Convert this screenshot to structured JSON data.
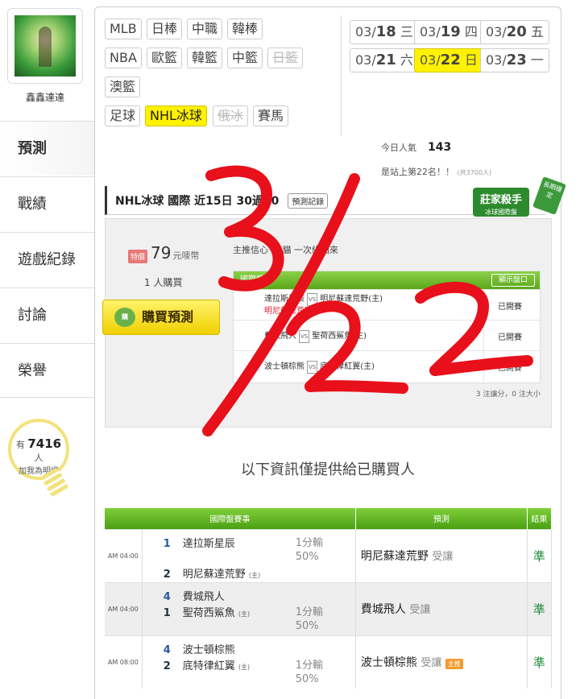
{
  "user": {
    "name": "鑫鑫達達"
  },
  "nav": [
    {
      "label": "預測",
      "active": true
    },
    {
      "label": "戰績",
      "active": false
    },
    {
      "label": "遊戲紀錄",
      "active": false
    },
    {
      "label": "討論",
      "active": false
    },
    {
      "label": "榮譽",
      "active": false
    }
  ],
  "fans": {
    "prefix": "有",
    "count": "7416",
    "unit": "人",
    "line2": "加我為明燈"
  },
  "leagues": [
    "MLB",
    "日棒",
    "中職",
    "韓棒",
    "NBA",
    "歐籃",
    "韓籃",
    "中籃",
    "日籃",
    "澳籃",
    "足球",
    "NHL冰球",
    "俄冰",
    "賽馬"
  ],
  "dates": [
    {
      "md": "03/",
      "d": "18",
      "w": "三"
    },
    {
      "md": "03/",
      "d": "19",
      "w": "四"
    },
    {
      "md": "03/",
      "d": "20",
      "w": "五"
    },
    {
      "md": "03/",
      "d": "21",
      "w": "六"
    },
    {
      "md": "03/",
      "d": "22",
      "w": "日"
    },
    {
      "md": "03/",
      "d": "23",
      "w": "一"
    }
  ],
  "stats": {
    "popularity_label": "今日人氣",
    "popularity": "143",
    "rank_text": "是站上第22名！！",
    "rank_total": "(共3700人)"
  },
  "section": {
    "title": "NHL冰球 國際 近15日 30過30",
    "record_button": "預測記錄"
  },
  "badge": {
    "main": "莊家殺手",
    "sub": "冰球國際盤",
    "ribbon": "長期穩定"
  },
  "purchase": {
    "price_tag": "特價",
    "price": "79",
    "price_unit": "元嘜幣",
    "buyers": "1 人購買",
    "buy_button": "購買預測",
    "buy_icon": "購",
    "note": "主推信心 %  貓 一次綠回來"
  },
  "mini_table": {
    "header": "國際盤",
    "show_button": "顯示盤口",
    "rows": [
      {
        "line1": "達拉斯星辰",
        "vs": "VS",
        "line1b": "明尼蘇達荒野(主)",
        "line2": "明尼蘇達荒野",
        "status": "已開賽"
      },
      {
        "line1": "費城飛人",
        "vs": "VS",
        "line1b": "聖荷西鯊魚(主)",
        "line2": "",
        "status": "已開賽"
      },
      {
        "line1": "波士頓棕熊",
        "vs": "VS",
        "line1b": "底特律紅翼(主)",
        "line2": "",
        "status": "已開賽"
      }
    ],
    "footer": "3 注讓分，0 注大小"
  },
  "info_text": "以下資訊僅提供給已購買人",
  "results": {
    "headers": [
      "國際盤賽事",
      "預測",
      "結果"
    ],
    "rows": [
      {
        "time": "AM 04:00",
        "n1": "1",
        "t1": "達拉斯星辰",
        "n2": "2",
        "t2": "明尼蘇達荒野",
        "host2": "(主)",
        "odds1": "1分輸",
        "odds2": "50%",
        "pick": "明尼蘇達荒野",
        "pick_sub": "受讓",
        "zhu": "",
        "result": "準"
      },
      {
        "time": "AM 04:00",
        "n1": "4",
        "t1": "費城飛人",
        "n2": "1",
        "t2": "聖荷西鯊魚",
        "host2": "(主)",
        "odds1": "1分輸",
        "odds2": "50%",
        "pick": "費城飛人",
        "pick_sub": "受讓",
        "zhu": "",
        "result": "準"
      },
      {
        "time": "AM 08:00",
        "n1": "4",
        "t1": "波士頓棕熊",
        "n2": "2",
        "t2": "底特律紅翼",
        "host2": "(主)",
        "odds1": "1分輸",
        "odds2": "50%",
        "pick": "波士頓棕熊",
        "pick_sub": "受讓",
        "zhu": "主推",
        "result": "準"
      }
    ]
  },
  "annotation": {
    "text": "3/22",
    "color": "#e8101a"
  }
}
